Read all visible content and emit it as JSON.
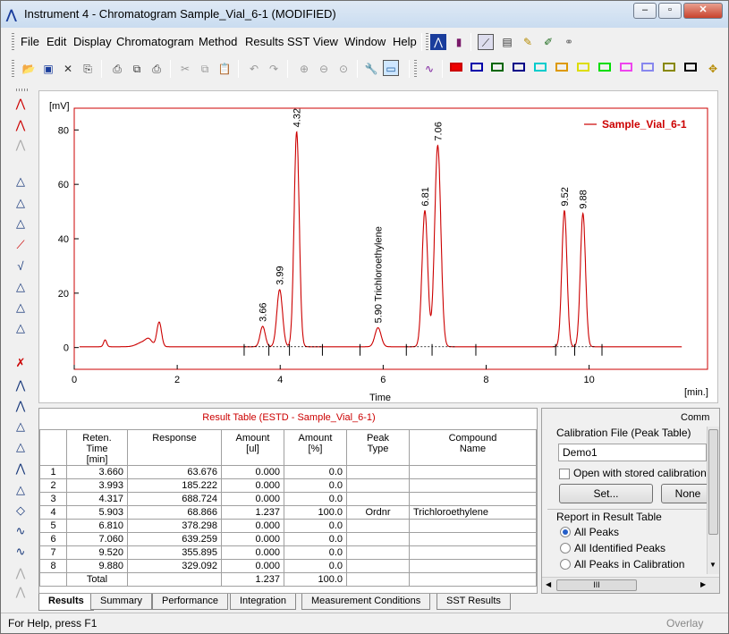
{
  "window": {
    "title": "Instrument 4 - Chromatogram  Sample_Vial_6-1 (MODIFIED)"
  },
  "menu": [
    "File",
    "Edit",
    "Display",
    "Chromatogram",
    "Method",
    "Results",
    "SST",
    "View",
    "Window",
    "Help"
  ],
  "chart_data": {
    "type": "line",
    "ylabel": "[mV]",
    "xlabel": "Time",
    "xunit": "[min.]",
    "xlim": [
      0,
      12.3
    ],
    "ylim": [
      -8,
      88
    ],
    "xticks": [
      "0",
      "2",
      "4",
      "6",
      "8",
      "10"
    ],
    "yticks": [
      "0",
      "20",
      "40",
      "60",
      "80"
    ],
    "series": [
      {
        "name": "Sample_Vial_6-1",
        "color": "#cc0000"
      }
    ],
    "peaks": [
      {
        "x": 0.6,
        "h": 2.5,
        "w": 0.03,
        "label": ""
      },
      {
        "x": 1.35,
        "h": 1.8,
        "w": 0.12,
        "label": ""
      },
      {
        "x": 1.45,
        "h": 1.8,
        "w": 0.06,
        "label": ""
      },
      {
        "x": 1.65,
        "h": 9,
        "w": 0.045,
        "label": ""
      },
      {
        "x": 3.66,
        "h": 7.5,
        "w": 0.05,
        "label": "3.66"
      },
      {
        "x": 3.99,
        "h": 21,
        "w": 0.055,
        "label": "3.99"
      },
      {
        "x": 4.32,
        "h": 79,
        "w": 0.05,
        "label": "4.32"
      },
      {
        "x": 5.9,
        "h": 7,
        "w": 0.06,
        "label": "5.90 Trichloroethylene"
      },
      {
        "x": 6.81,
        "h": 50,
        "w": 0.055,
        "label": "6.81"
      },
      {
        "x": 7.06,
        "h": 74,
        "w": 0.06,
        "label": "7.06"
      },
      {
        "x": 9.52,
        "h": 50,
        "w": 0.05,
        "label": "9.52"
      },
      {
        "x": 9.88,
        "h": 49,
        "w": 0.05,
        "label": "9.88"
      }
    ],
    "baseline_marks": [
      3.3,
      3.78,
      4.18,
      4.82,
      5.55,
      6.45,
      6.95,
      7.8,
      9.35,
      9.72,
      10.25
    ]
  },
  "results": {
    "title": "Result Table (ESTD - Sample_Vial_6-1)",
    "headers": [
      "",
      "Reten. Time\n[min]",
      "Response",
      "Amount\n[ul]",
      "Amount\n[%]",
      "Peak\nType",
      "Compound\nName"
    ],
    "rows": [
      [
        "1",
        "3.660",
        "63.676",
        "0.000",
        "0.0",
        "",
        ""
      ],
      [
        "2",
        "3.993",
        "185.222",
        "0.000",
        "0.0",
        "",
        ""
      ],
      [
        "3",
        "4.317",
        "688.724",
        "0.000",
        "0.0",
        "",
        ""
      ],
      [
        "4",
        "5.903",
        "68.866",
        "1.237",
        "100.0",
        "Ordnr",
        "Trichloroethylene"
      ],
      [
        "5",
        "6.810",
        "378.298",
        "0.000",
        "0.0",
        "",
        ""
      ],
      [
        "6",
        "7.060",
        "639.259",
        "0.000",
        "0.0",
        "",
        ""
      ],
      [
        "7",
        "9.520",
        "355.895",
        "0.000",
        "0.0",
        "",
        ""
      ],
      [
        "8",
        "9.880",
        "329.092",
        "0.000",
        "0.0",
        "",
        ""
      ]
    ],
    "total": [
      "",
      "Total",
      "",
      "1.237",
      "100.0",
      "",
      ""
    ]
  },
  "calib": {
    "header": "Comm",
    "file_label": "Calibration File (Peak Table)",
    "file_value": "Demo1",
    "stored_label": "Open with stored calibration",
    "set_label": "Set...",
    "none_label": "None",
    "report_label": "Report in Result Table",
    "options": [
      "All Peaks",
      "All Identified Peaks",
      "All Peaks in Calibration"
    ],
    "scroll_label": "III"
  },
  "tabs": [
    "Results",
    "Summary",
    "Performance",
    "Integration",
    "Measurement Conditions",
    "SST Results"
  ],
  "status": {
    "help": "For Help, press F1",
    "mode": "Overlay"
  },
  "colors": {
    "accent": "#cc0000",
    "selected_radio": "#245ec8"
  }
}
